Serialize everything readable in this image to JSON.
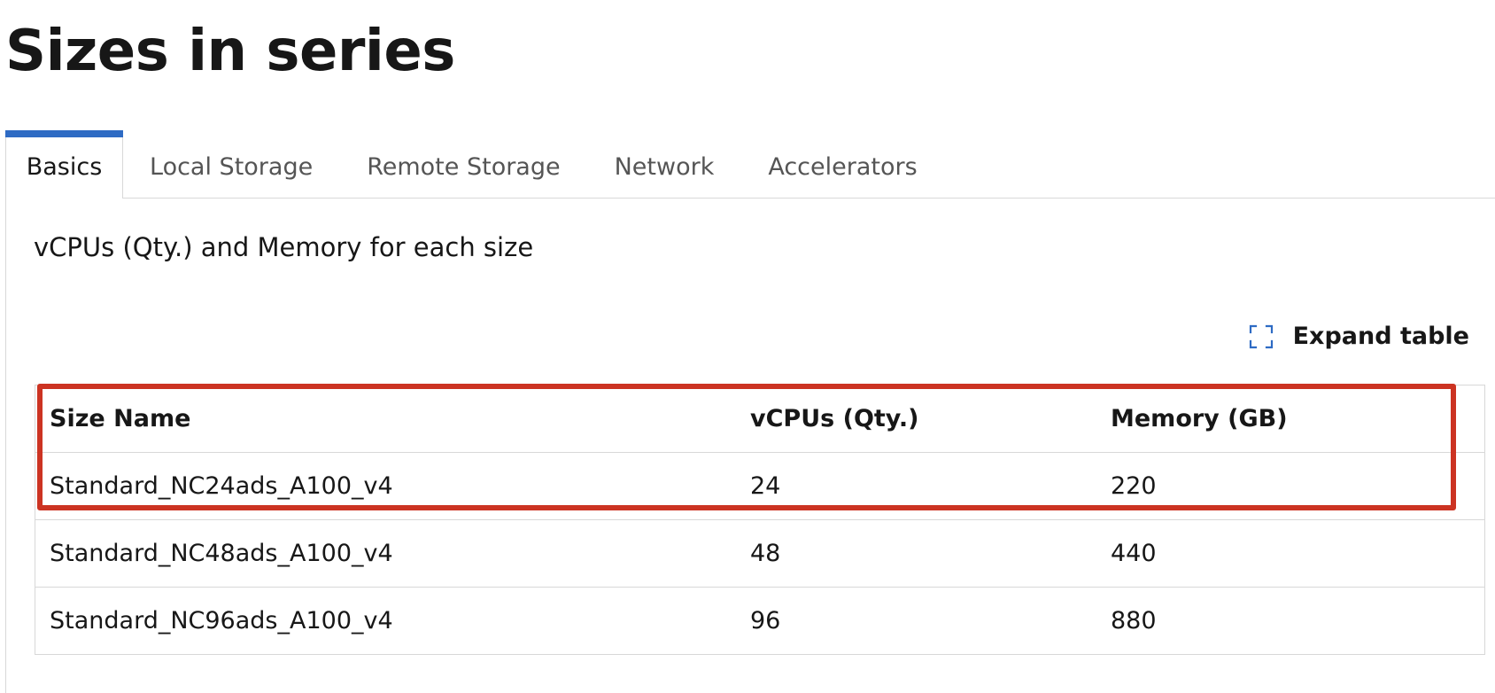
{
  "page": {
    "title": "Sizes in series"
  },
  "tabs": [
    {
      "label": "Basics",
      "active": true
    },
    {
      "label": "Local Storage",
      "active": false
    },
    {
      "label": "Remote Storage",
      "active": false
    },
    {
      "label": "Network",
      "active": false
    },
    {
      "label": "Accelerators",
      "active": false
    }
  ],
  "section": {
    "heading": "vCPUs (Qty.) and Memory for each size"
  },
  "toolbar": {
    "expand_label": "Expand table",
    "expand_icon": "expand-icon"
  },
  "table": {
    "headers": [
      "Size Name",
      "vCPUs (Qty.)",
      "Memory (GB)"
    ],
    "rows": [
      [
        "Standard_NC24ads_A100_v4",
        "24",
        "220"
      ],
      [
        "Standard_NC48ads_A100_v4",
        "48",
        "440"
      ],
      [
        "Standard_NC96ads_A100_v4",
        "96",
        "880"
      ]
    ]
  },
  "colors": {
    "accent": "#2e6bc4",
    "highlight": "#cc3322",
    "border": "#d8d8d8"
  }
}
